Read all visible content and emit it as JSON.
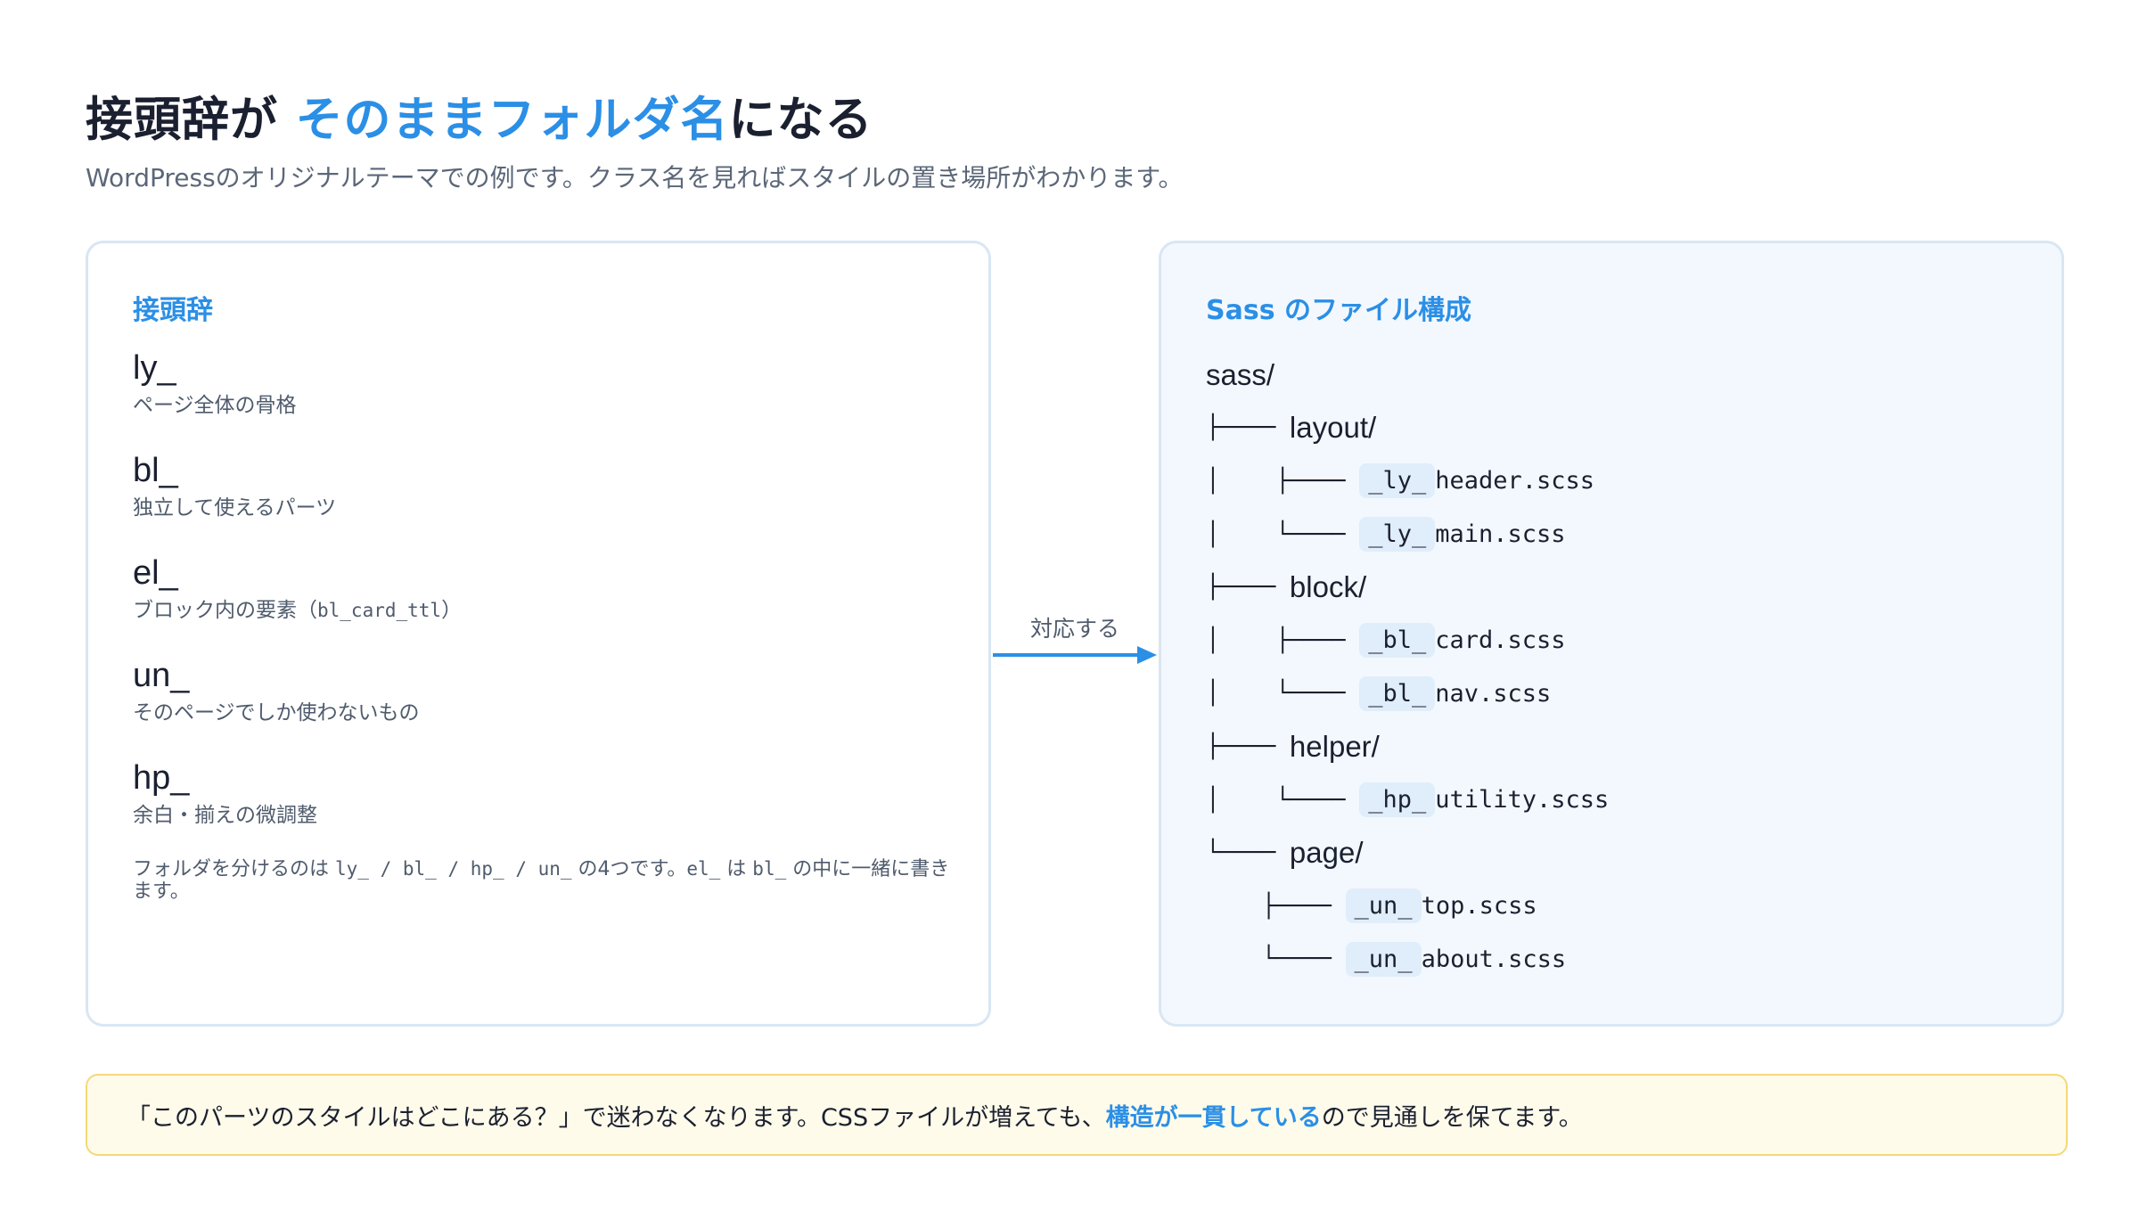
{
  "header": {
    "title_before": "接頭辞が ",
    "title_accent": "そのままフォルダ名",
    "title_after": "になる",
    "subtitle": "WordPressのオリジナルテーマでの例です。クラス名を見ればスタイルの置き場所がわかります。"
  },
  "left_panel": {
    "heading": "接頭辞",
    "items": [
      {
        "code": "ly_",
        "desc": "ページ全体の骨格"
      },
      {
        "code": "bl_",
        "desc": "独立して使えるパーツ"
      },
      {
        "code": "el_",
        "desc_before": "ブロック内の要素（",
        "desc_code": "bl_card_ttl",
        "desc_after": "）"
      },
      {
        "code": "un_",
        "desc": "そのページでしか使わないもの"
      },
      {
        "code": "hp_",
        "desc": "余白・揃えの微調整"
      }
    ],
    "note": {
      "t1": "フォルダを分けるのは ",
      "c1": "ly_",
      "s1": " / ",
      "c2": "bl_",
      "s2": " / ",
      "c3": "hp_",
      "s3": " / ",
      "c4": "un_",
      "t2": " の4つです。",
      "c5": "el_",
      "t3": " は ",
      "c6": "bl_",
      "t4": " の中に一緒に書きます。"
    }
  },
  "connector": {
    "label": "対応する",
    "color": "#2b8fe6"
  },
  "right_panel": {
    "heading": "Sass のファイル構成",
    "tree": [
      {
        "guide": "",
        "name": "sass/"
      },
      {
        "guide": "├──── ",
        "name": "layout/"
      },
      {
        "guide": "│    ├──── ",
        "prefix": "_ly_",
        "name": "header.scss"
      },
      {
        "guide": "│    └──── ",
        "prefix": "_ly_",
        "name": "main.scss"
      },
      {
        "guide": "├──── ",
        "name": "block/"
      },
      {
        "guide": "│    ├──── ",
        "prefix": "_bl_",
        "name": "card.scss"
      },
      {
        "guide": "│    └──── ",
        "prefix": "_bl_",
        "name": "nav.scss"
      },
      {
        "guide": "├──── ",
        "name": "helper/"
      },
      {
        "guide": "│    └──── ",
        "prefix": "_hp_",
        "name": "utility.scss"
      },
      {
        "guide": "└──── ",
        "name": "page/"
      },
      {
        "guide": "    ├──── ",
        "prefix": "_un_",
        "name": "top.scss"
      },
      {
        "guide": "    └──── ",
        "prefix": "_un_",
        "name": "about.scss"
      }
    ]
  },
  "footer": {
    "before": "「このパーツのスタイルはどこにある？」で迷わなくなります。CSSファイルが増えても、",
    "highlight": "構造が一貫している",
    "after": "ので見通しを保てます。"
  },
  "colors": {
    "accent": "#2b8fe6",
    "panel_border": "#d9e6f4",
    "footer_bg": "#fffbea",
    "footer_border": "#f3d978"
  }
}
